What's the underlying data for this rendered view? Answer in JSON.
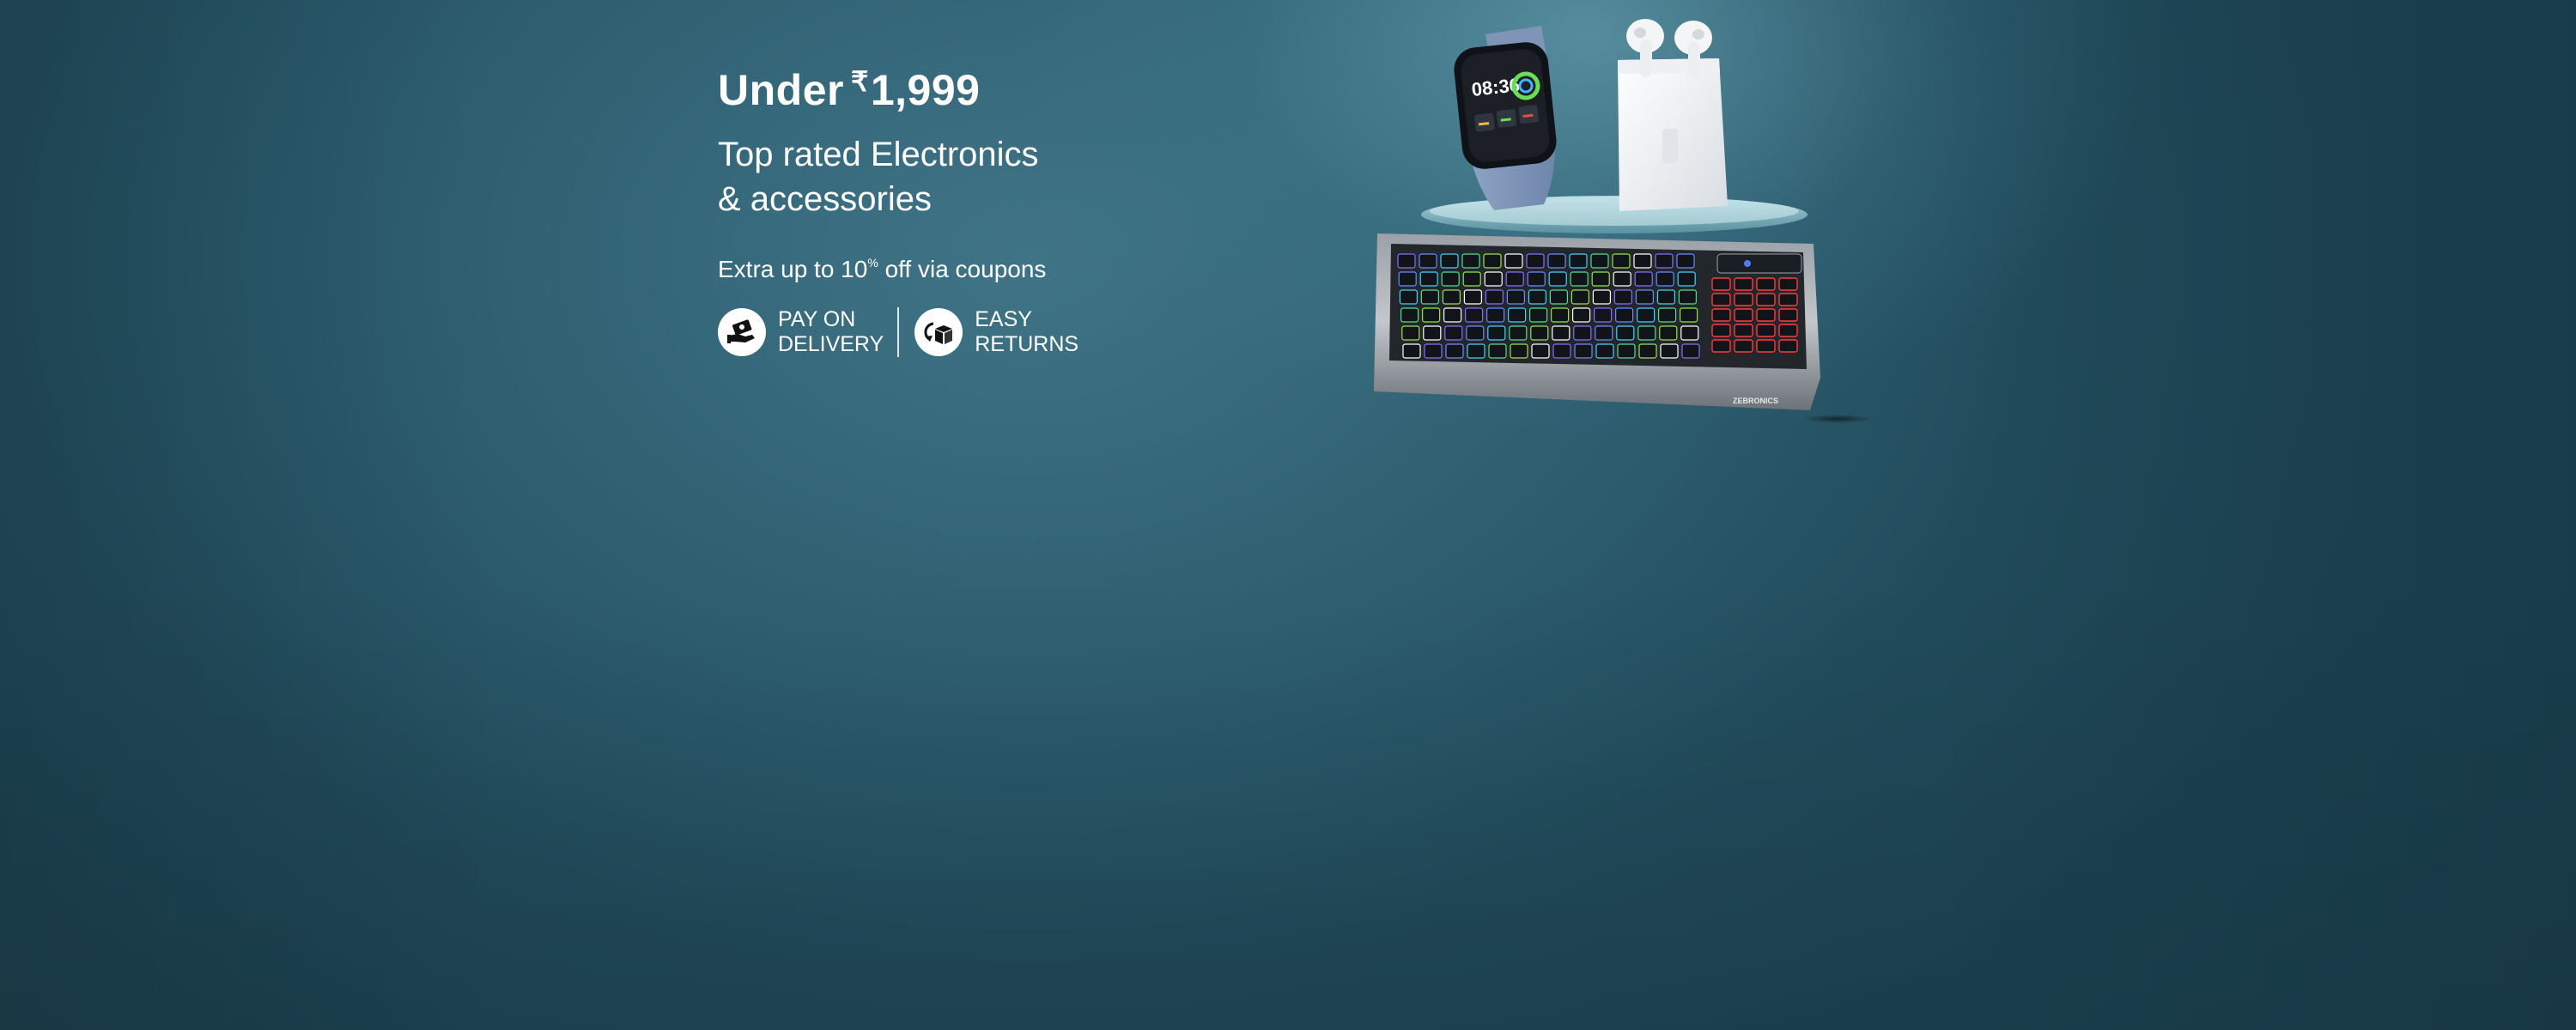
{
  "banner": {
    "headline": {
      "prefix": "Under",
      "currency_symbol": "₹",
      "amount": "1,999"
    },
    "subhead_line1": "Top rated Electronics",
    "subhead_line2": "& accessories",
    "offer": {
      "before": "Extra up to 10",
      "superscript": "%",
      "after": " off via coupons"
    },
    "badges": [
      {
        "line1": "PAY ON",
        "line2": "DELIVERY",
        "icon": "cash-on-delivery-icon"
      },
      {
        "line1": "EASY",
        "line2": "RETURNS",
        "icon": "easy-returns-icon"
      }
    ],
    "products": {
      "watch_time": "08:36",
      "keyboard_brand": "ZEBRONICS"
    },
    "colors": {
      "background": "#2d5e70",
      "text": "#ffffff"
    }
  }
}
